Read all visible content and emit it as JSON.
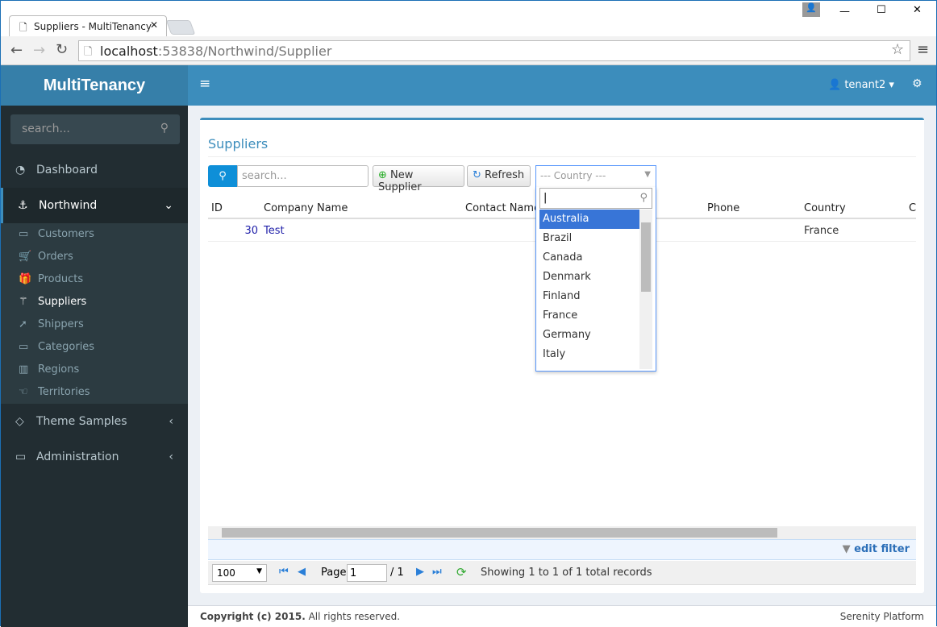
{
  "browser": {
    "tab_title": "Suppliers - MultiTenancy",
    "url_host": "localhost",
    "url_path": ":53838/Northwind/Supplier"
  },
  "app": {
    "logo": "MultiTenancy",
    "user": "tenant2"
  },
  "sidebar": {
    "search_placeholder": "search...",
    "items": [
      {
        "label": "Dashboard",
        "icon": "dashboard-icon"
      },
      {
        "label": "Northwind",
        "icon": "anchor-icon"
      },
      {
        "label": "Theme Samples",
        "icon": "diamond-icon"
      },
      {
        "label": "Administration",
        "icon": "desktop-icon"
      }
    ],
    "subitems": [
      {
        "label": "Customers",
        "icon": "folder-icon"
      },
      {
        "label": "Orders",
        "icon": "cart-icon"
      },
      {
        "label": "Products",
        "icon": "gift-icon"
      },
      {
        "label": "Suppliers",
        "icon": "magic-icon"
      },
      {
        "label": "Shippers",
        "icon": "rocket-icon"
      },
      {
        "label": "Categories",
        "icon": "folder-icon"
      },
      {
        "label": "Regions",
        "icon": "map-icon"
      },
      {
        "label": "Territories",
        "icon": "hand-icon"
      }
    ]
  },
  "page": {
    "title": "Suppliers",
    "search_placeholder": "search...",
    "new_button": "New Supplier",
    "refresh_button": "Refresh",
    "country_placeholder": "--- Country ---"
  },
  "grid": {
    "columns": [
      "ID",
      "Company Name",
      "Contact Name",
      "Phone",
      "Country",
      "C"
    ],
    "rows": [
      {
        "id": "30",
        "company": "Test",
        "country": "France"
      }
    ]
  },
  "dropdown": {
    "options": [
      "Australia",
      "Brazil",
      "Canada",
      "Denmark",
      "Finland",
      "France",
      "Germany",
      "Italy"
    ],
    "selected": "Australia"
  },
  "pager": {
    "page_size": "100",
    "page_label": "Page",
    "page": "1",
    "total_pages": "/ 1",
    "status": "Showing 1 to 1 of 1 total records",
    "edit_filter": "edit filter"
  },
  "footer": {
    "copyright_bold": "Copyright (c) 2015.",
    "copyright_rest": " All rights reserved.",
    "platform": "Serenity Platform"
  },
  "colors": {
    "accent": "#3c8dbc",
    "sidebar": "#222d32",
    "selected": "#3875d7"
  }
}
